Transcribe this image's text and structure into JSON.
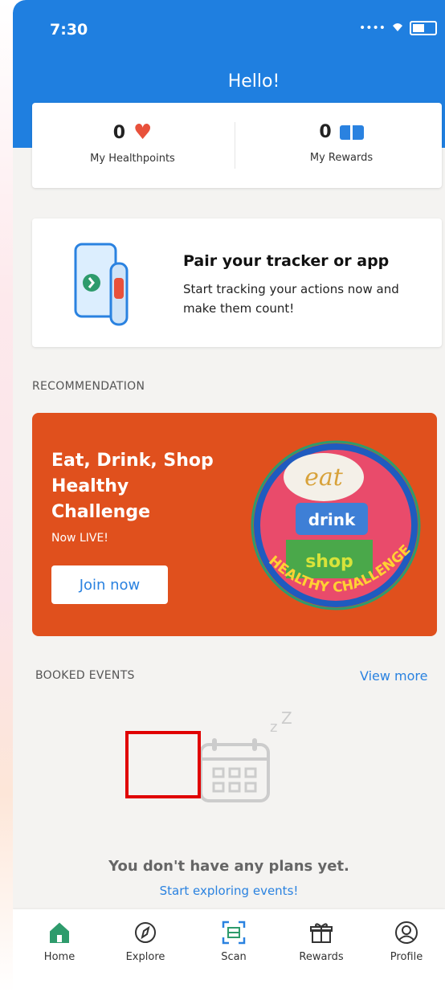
{
  "status_bar": {
    "time": "7:30"
  },
  "header": {
    "greeting": "Hello!"
  },
  "points": {
    "healthpoints_value": "0",
    "healthpoints_label": "My Healthpoints",
    "rewards_value": "0",
    "rewards_label": "My Rewards"
  },
  "pair_card": {
    "title": "Pair your tracker or app",
    "description": "Start tracking your actions now and make them count!"
  },
  "recommendation": {
    "section_label": "RECOMMENDATION",
    "promo_title": "Eat, Drink, Shop Healthy Challenge",
    "promo_subtitle": "Now LIVE!",
    "promo_button": "Join now",
    "promo_art_caption": "HEALTHY CHALLENGE"
  },
  "booked_events": {
    "section_label": "BOOKED EVENTS",
    "view_more": "View more",
    "empty_title": "You don't have any plans yet.",
    "empty_link": "Start exploring events!"
  },
  "tabs": [
    {
      "label": "Home",
      "icon": "home-icon"
    },
    {
      "label": "Explore",
      "icon": "compass-icon"
    },
    {
      "label": "Scan",
      "icon": "scan-icon"
    },
    {
      "label": "Rewards",
      "icon": "gift-icon"
    },
    {
      "label": "Profile",
      "icon": "profile-icon"
    }
  ],
  "colors": {
    "header_blue": "#1f7fe0",
    "accent_blue": "#2a82e0",
    "promo_orange": "#e0501d",
    "heart_red": "#e8513b",
    "home_green": "#2e9b6c"
  }
}
